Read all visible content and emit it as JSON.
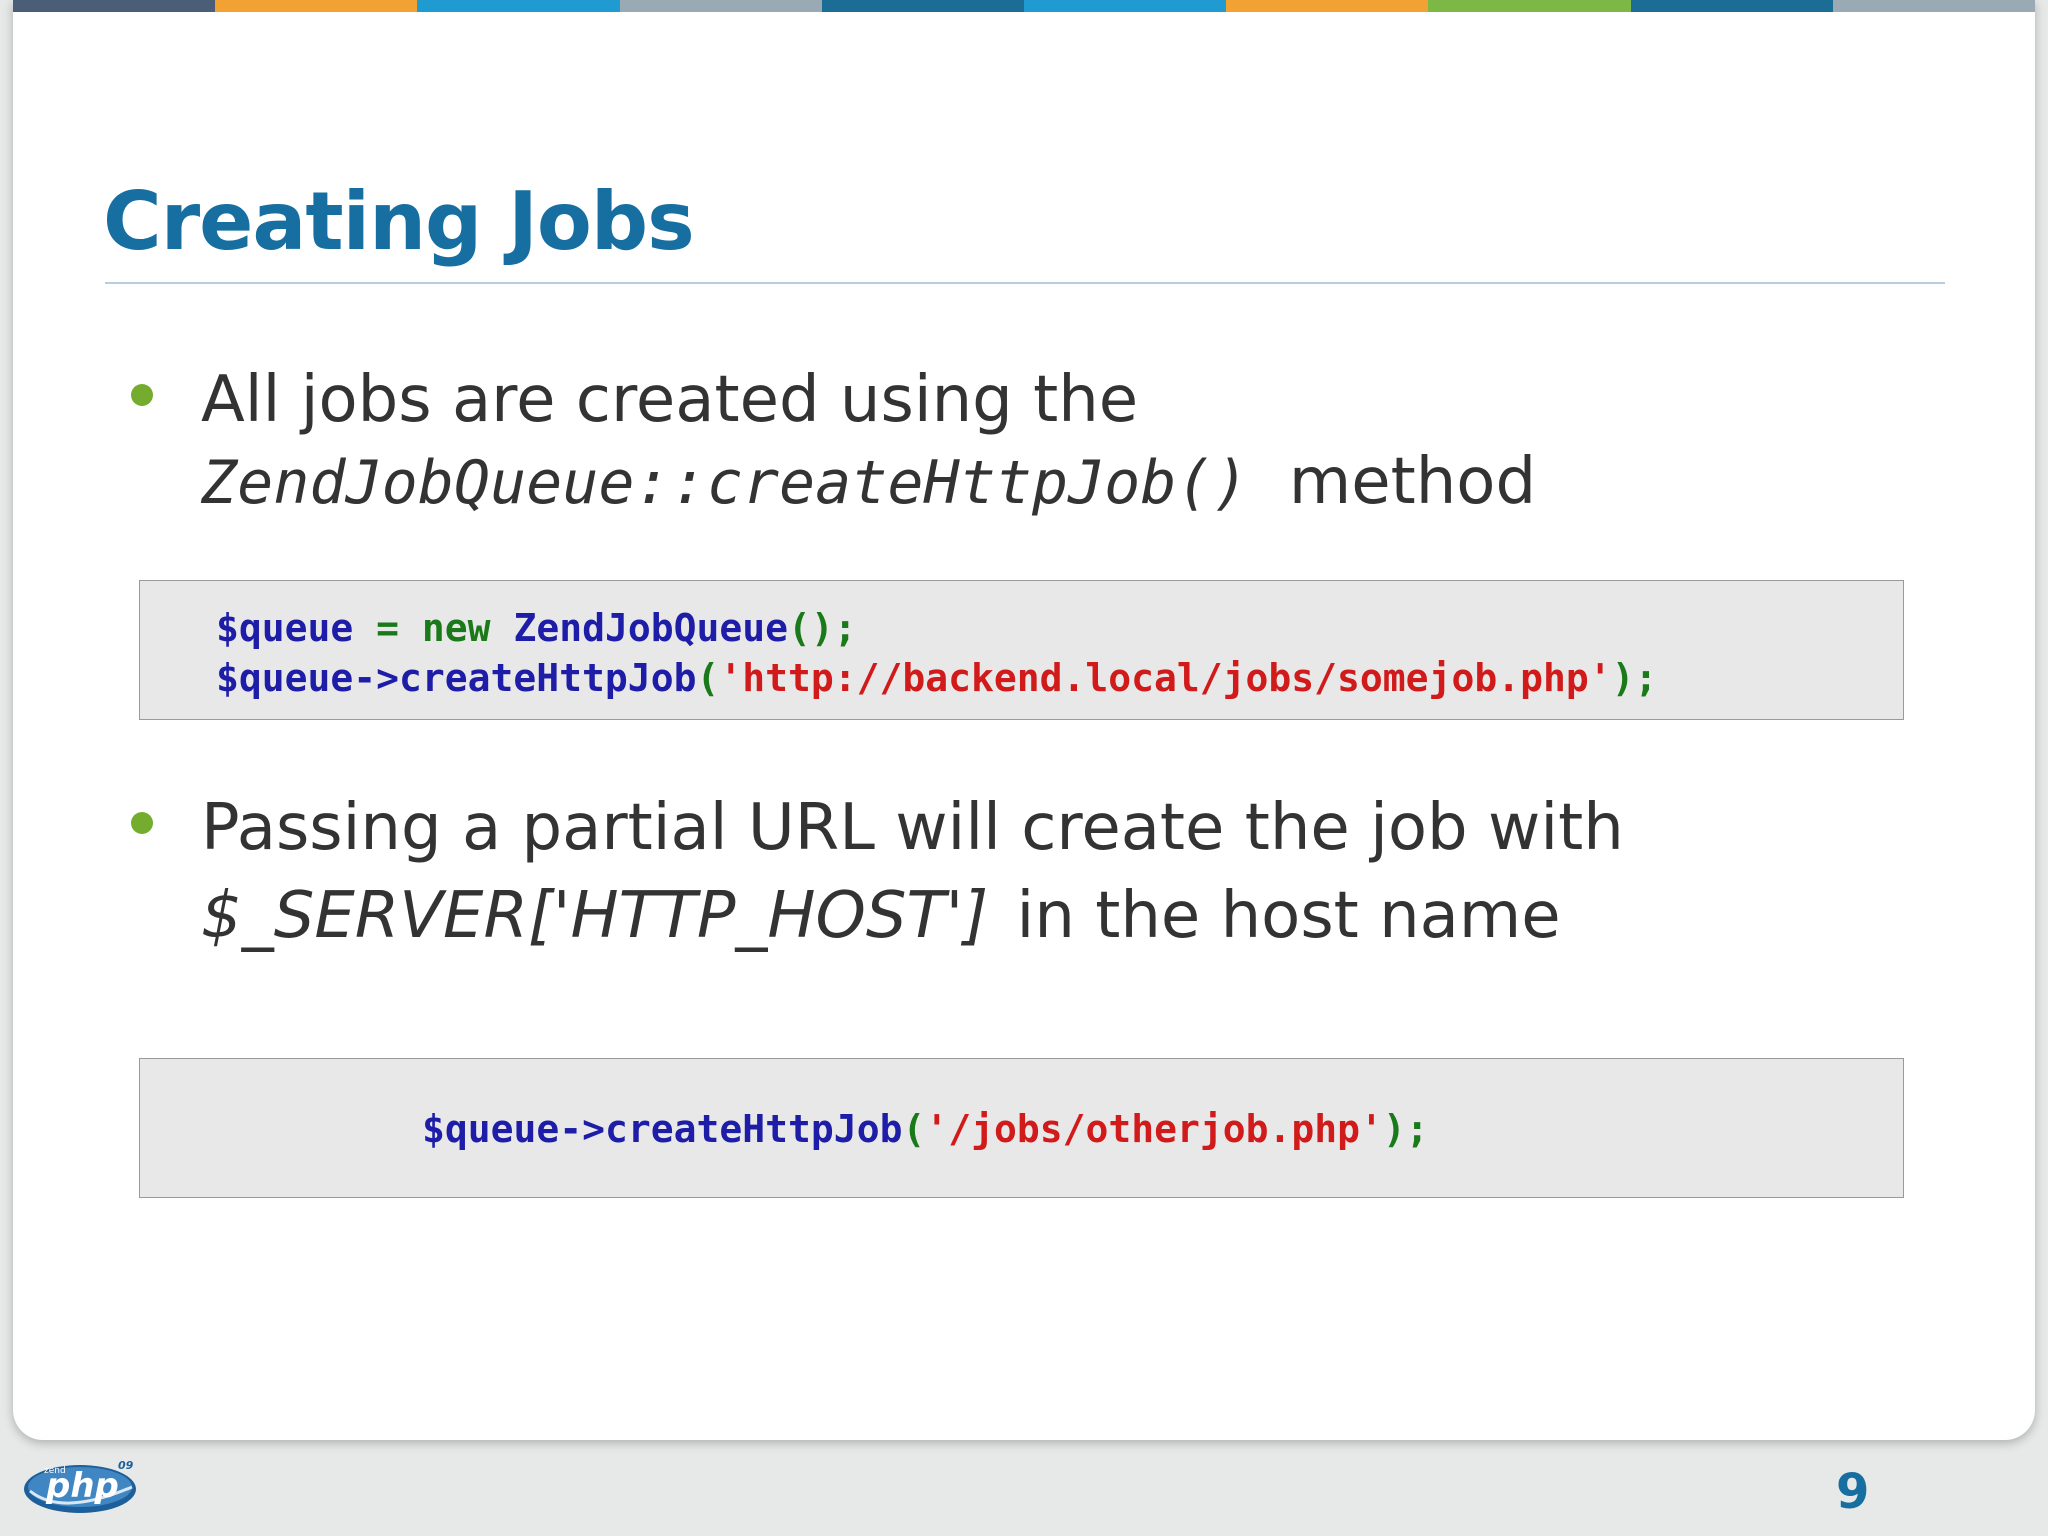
{
  "colors": {
    "title": "#166fa0",
    "bullet": "#74ad2e",
    "code_variable": "#1d1da8",
    "code_string": "#d11a1a",
    "code_operator": "#1a7a1a",
    "code_background": "#e9e8e9",
    "top_bar": [
      "#4a5f77",
      "#f2a233",
      "#1f9bd2",
      "#9aaab5",
      "#1c6d96",
      "#1f9bd2",
      "#f2a233",
      "#7db745",
      "#1c6d96",
      "#9aaab5"
    ]
  },
  "slide": {
    "title": "Creating Jobs",
    "bullets": [
      {
        "line1": "All jobs are created using the",
        "line2_code": "ZendJobQueue::createHttpJob()",
        "line2_text": "method"
      },
      {
        "line1": "Passing a partial URL will create the job with",
        "line2_italic": "$_SERVER['HTTP_HOST']",
        "line2_text": "in the host name"
      }
    ],
    "code_block_1": {
      "line1": {
        "var": "$queue",
        "op": " = ",
        "kw": "new ",
        "cls": "ZendJobQueue",
        "punc": "();"
      },
      "line2": {
        "var": "$queue->",
        "fn": "createHttpJob",
        "open": "(",
        "str": "'http://backend.local/jobs/somejob.php'",
        "close": ");"
      }
    },
    "code_block_2": {
      "line1": {
        "var": "$queue->",
        "fn": "createHttpJob",
        "open": "(",
        "str": "'/jobs/otherjob.php'",
        "close": ");"
      }
    }
  },
  "footer": {
    "logo_text": "php",
    "logo_small": "zend",
    "logo_year": "09",
    "page_number": "9"
  }
}
